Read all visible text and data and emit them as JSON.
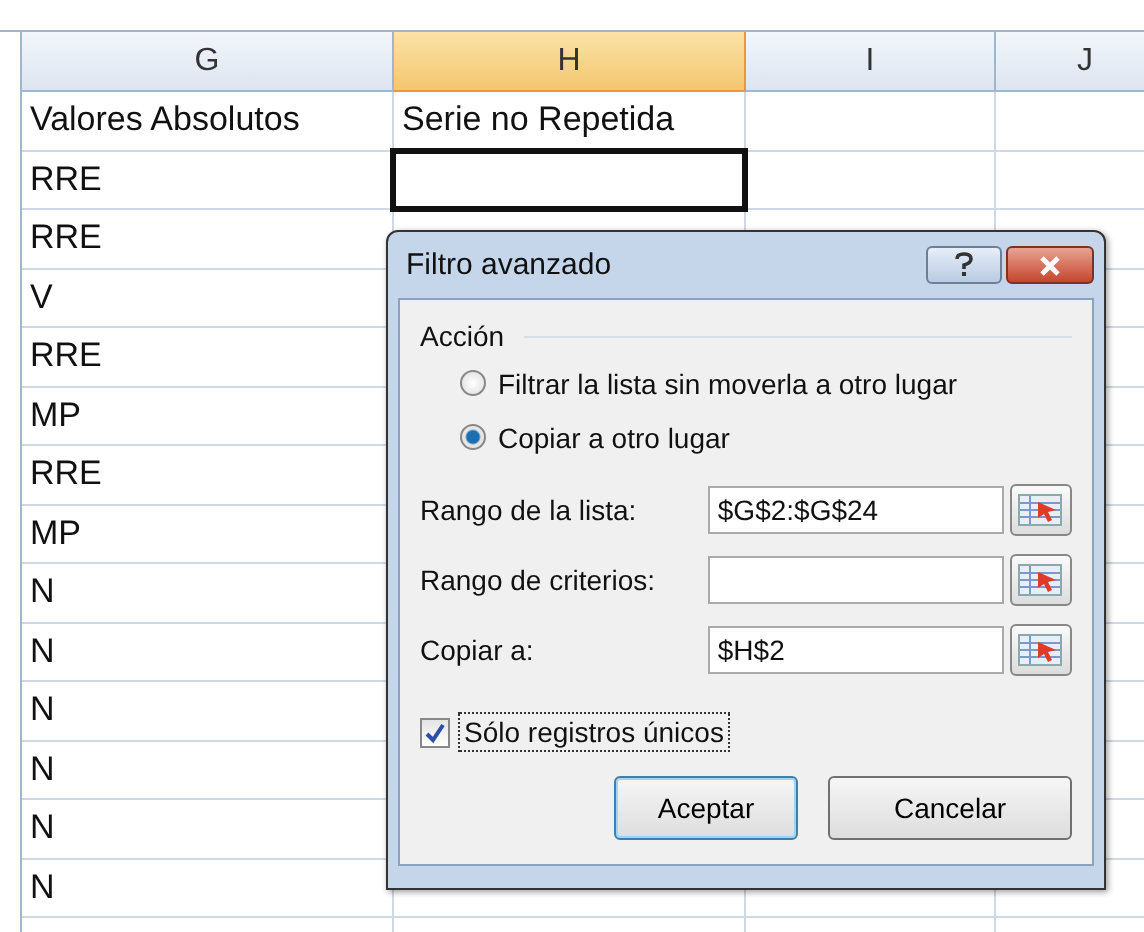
{
  "columns": [
    {
      "label": "G",
      "selected": false
    },
    {
      "label": "H",
      "selected": true
    },
    {
      "label": "I",
      "selected": false
    },
    {
      "label": "J",
      "selected": false
    }
  ],
  "rows": [
    {
      "cells": [
        "Valores Absolutos",
        "Serie no Repetida"
      ],
      "selected": false
    },
    {
      "cells": [
        "RRE"
      ],
      "selected": true
    },
    {
      "cells": [
        "RRE"
      ],
      "selected": false
    },
    {
      "cells": [
        "V"
      ],
      "selected": false
    },
    {
      "cells": [
        "RRE"
      ],
      "selected": false
    },
    {
      "cells": [
        "MP"
      ],
      "selected": false
    },
    {
      "cells": [
        "RRE"
      ],
      "selected": false
    },
    {
      "cells": [
        "MP"
      ],
      "selected": false
    },
    {
      "cells": [
        "N"
      ],
      "selected": false
    },
    {
      "cells": [
        "N"
      ],
      "selected": false
    },
    {
      "cells": [
        "N"
      ],
      "selected": false
    },
    {
      "cells": [
        "N"
      ],
      "selected": false
    },
    {
      "cells": [
        "N"
      ],
      "selected": false
    },
    {
      "cells": [
        "N"
      ],
      "selected": false
    }
  ],
  "dialog": {
    "title": "Filtro avanzado",
    "group_label": "Acción",
    "options": [
      {
        "label": "Filtrar la lista sin moverla a otro lugar",
        "selected": false
      },
      {
        "label": "Copiar a otro lugar",
        "selected": true
      }
    ],
    "fields": [
      {
        "label": "Rango de la lista:",
        "value": "$G$2:$G$24"
      },
      {
        "label": "Rango de criterios:"
      },
      {
        "label": "Copiar a:",
        "value": "$H$2"
      }
    ],
    "checkbox": {
      "label": "Sólo registros únicos",
      "checked": true
    },
    "buttons": [
      {
        "label": "Aceptar",
        "default": true
      },
      {
        "label": "Cancelar",
        "default": false
      }
    ]
  }
}
